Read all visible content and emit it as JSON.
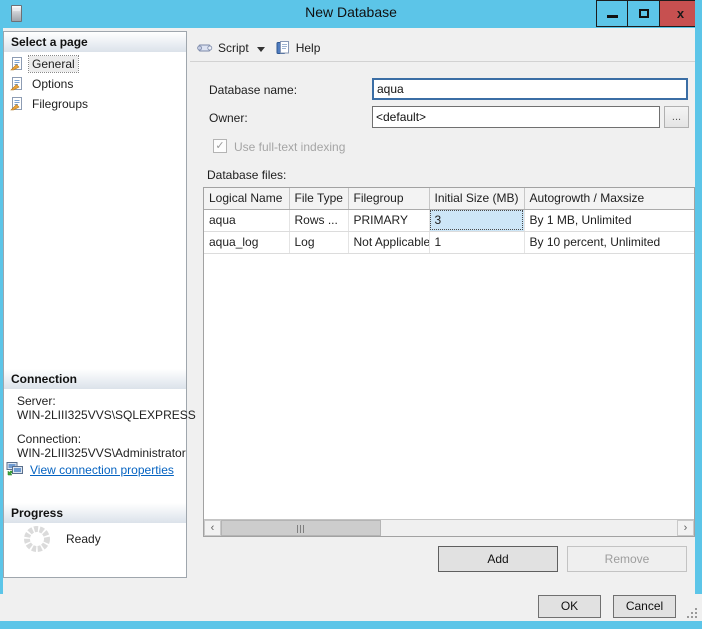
{
  "window": {
    "title": "New Database",
    "close_glyph": "x"
  },
  "toolbar": {
    "script_label": "Script",
    "help_label": "Help"
  },
  "sidebar": {
    "pages_header": "Select a page",
    "pages": [
      {
        "label": "General"
      },
      {
        "label": "Options"
      },
      {
        "label": "Filegroups"
      }
    ],
    "connection_header": "Connection",
    "server_label": "Server:",
    "server_value": "WIN-2LIII325VVS\\SQLEXPRESS",
    "connection_label": "Connection:",
    "connection_value": "WIN-2LIII325VVS\\Administrator",
    "view_connection_link": "View connection properties",
    "progress_header": "Progress",
    "progress_status": "Ready"
  },
  "form": {
    "database_name_label": "Database name:",
    "database_name_value": "aqua",
    "owner_label": "Owner:",
    "owner_value": "<default>",
    "browse_label": "...",
    "fulltext_label": "Use full-text indexing",
    "fulltext_checked_glyph": "✓",
    "files_label": "Database files:"
  },
  "table": {
    "columns": [
      "Logical Name",
      "File Type",
      "Filegroup",
      "Initial Size (MB)",
      "Autogrowth / Maxsize"
    ],
    "rows": [
      [
        "aqua",
        "Rows ...",
        "PRIMARY",
        "3",
        "By 1 MB, Unlimited"
      ],
      [
        "aqua_log",
        "Log",
        "Not Applicable",
        "1",
        "By 10 percent, Unlimited"
      ]
    ]
  },
  "scrollbar": {
    "left_arrow": "‹",
    "right_arrow": "›"
  },
  "buttons": {
    "add": "Add",
    "remove": "Remove",
    "ok": "OK",
    "cancel": "Cancel"
  },
  "colors": {
    "titlebar": "#5cc5e8",
    "close_button": "#c75050",
    "focused_input_border": "#3b6ea5",
    "link": "#0563c1",
    "selected_cell": "#cde6f7"
  }
}
